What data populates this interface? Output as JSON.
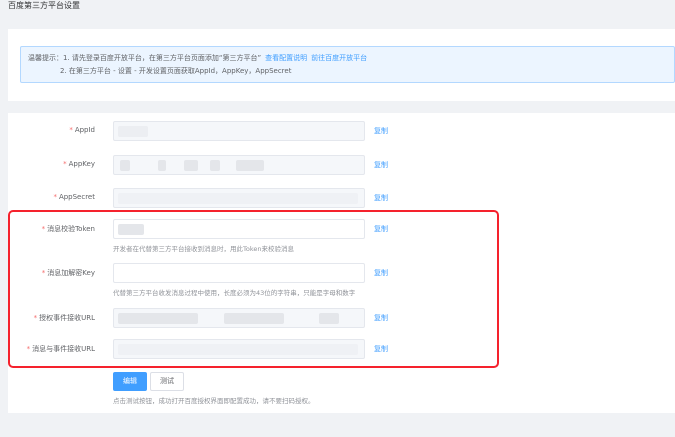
{
  "page": {
    "title": "百度第三方平台设置"
  },
  "tip": {
    "line1_text": "温馨提示：1. 请先登录百度开放平台，在第三方平台页面添加“第三方平台”",
    "link_config": "查看配置说明",
    "link_open": "前往百度开放平台",
    "line2_text": "2. 在第三方平台 - 设置 - 开发设置页面获取AppId，AppKey，AppSecret"
  },
  "fields": [
    {
      "label": "AppId",
      "required": "*",
      "copy": "复制"
    },
    {
      "label": "AppKey",
      "required": "*",
      "copy": "复制"
    },
    {
      "label": "AppSecret",
      "required": "*",
      "copy": "复制"
    },
    {
      "label": "消息校验Token",
      "required": "*",
      "copy": "复制",
      "hint": "开发者在代替第三方平台接收到消息时，用此Token来校验消息"
    },
    {
      "label": "消息加解密Key",
      "required": "*",
      "copy": "复制",
      "hint": "代替第三方平台收发消息过程中使用，长度必须为43位的字符串，只能是字母和数字"
    },
    {
      "label": "授权事件接收URL",
      "required": "*",
      "copy": "复制"
    },
    {
      "label": "消息与事件接收URL",
      "required": "*",
      "copy": "复制"
    }
  ],
  "buttons": {
    "edit": "编辑",
    "test": "测试"
  },
  "bottom_hint": "点击测试按钮，成功打开百度授权界面即配置成功，请不要扫码授权。",
  "colors": {
    "accent": "#409eff",
    "required": "#f56c6c",
    "highlight_border": "#f5222d",
    "tip_background": "#ecf5ff"
  }
}
